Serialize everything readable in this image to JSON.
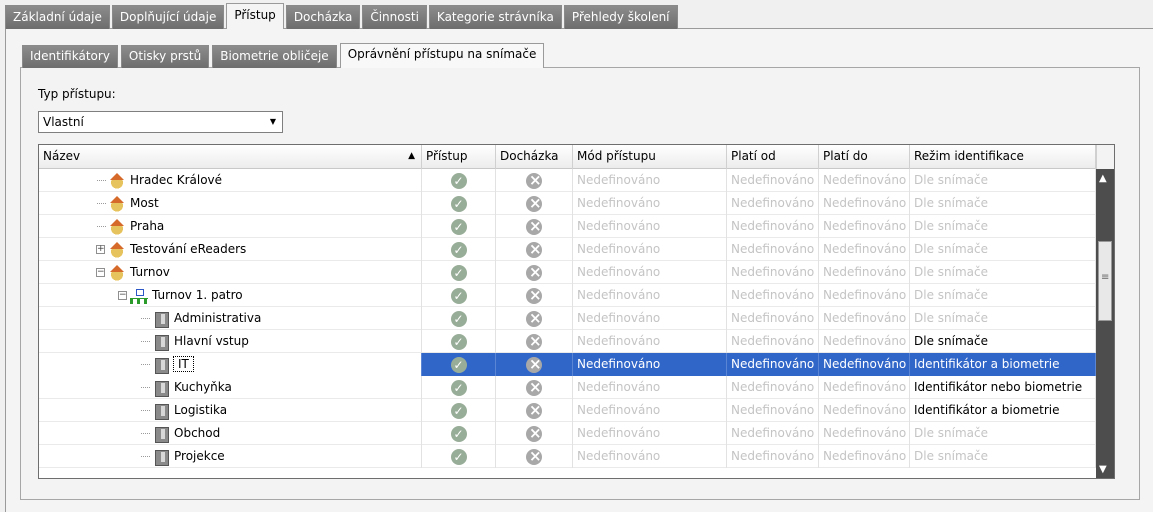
{
  "tabs_top": [
    "Základní údaje",
    "Doplňující údaje",
    "Přístup",
    "Docházka",
    "Činnosti",
    "Kategorie strávníka",
    "Přehledy školení"
  ],
  "tabs_top_active": 2,
  "tabs_inner": [
    "Identifikátory",
    "Otisky prstů",
    "Biometrie obličeje",
    "Oprávnění přístupu na snímače"
  ],
  "tabs_inner_active": 3,
  "access_type": {
    "label": "Typ přístupu:",
    "value": "Vlastní"
  },
  "grid": {
    "columns": [
      "Název",
      "Přístup",
      "Docházka",
      "Mód přístupu",
      "Platí od",
      "Platí do",
      "Režim identifikace"
    ],
    "rows": [
      {
        "name": "Hradec Králové",
        "icon": "house",
        "level": 1,
        "expander": "",
        "access": "ok",
        "attendance": "no",
        "mode": "Nedefinováno",
        "from": "Nedefinováno",
        "to": "Nedefinováno",
        "regime": "Dle snímače",
        "mode_muted": true,
        "regime_muted": true
      },
      {
        "name": "Most",
        "icon": "house",
        "level": 1,
        "expander": "",
        "access": "ok",
        "attendance": "no",
        "mode": "Nedefinováno",
        "from": "Nedefinováno",
        "to": "Nedefinováno",
        "regime": "Dle snímače",
        "mode_muted": true,
        "regime_muted": true
      },
      {
        "name": "Praha",
        "icon": "house",
        "level": 1,
        "expander": "",
        "access": "ok",
        "attendance": "no",
        "mode": "Nedefinováno",
        "from": "Nedefinováno",
        "to": "Nedefinováno",
        "regime": "Dle snímače",
        "mode_muted": true,
        "regime_muted": true
      },
      {
        "name": "Testování eReaders",
        "icon": "house",
        "level": 1,
        "expander": "+",
        "access": "ok",
        "attendance": "no",
        "mode": "Nedefinováno",
        "from": "Nedefinováno",
        "to": "Nedefinováno",
        "regime": "Dle snímače",
        "mode_muted": true,
        "regime_muted": true
      },
      {
        "name": "Turnov",
        "icon": "house",
        "level": 1,
        "expander": "−",
        "access": "ok",
        "attendance": "no",
        "mode": "Nedefinováno",
        "from": "Nedefinováno",
        "to": "Nedefinováno",
        "regime": "Dle snímače",
        "mode_muted": true,
        "regime_muted": true
      },
      {
        "name": "Turnov 1. patro",
        "icon": "net",
        "level": 2,
        "expander": "−",
        "access": "ok",
        "attendance": "no",
        "mode": "Nedefinováno",
        "from": "Nedefinováno",
        "to": "Nedefinováno",
        "regime": "Dle snímače",
        "mode_muted": true,
        "regime_muted": true
      },
      {
        "name": "Administrativa",
        "icon": "door",
        "level": 3,
        "expander": "",
        "access": "ok",
        "attendance": "no",
        "mode": "Nedefinováno",
        "from": "Nedefinováno",
        "to": "Nedefinováno",
        "regime": "Dle snímače",
        "mode_muted": true,
        "regime_muted": true
      },
      {
        "name": "Hlavní vstup",
        "icon": "door",
        "level": 3,
        "expander": "",
        "access": "ok",
        "attendance": "no",
        "mode": "Nedefinováno",
        "from": "Nedefinováno",
        "to": "Nedefinováno",
        "regime": "Dle snímače",
        "mode_muted": true,
        "regime_muted": false
      },
      {
        "name": "IT",
        "icon": "door",
        "level": 3,
        "expander": "",
        "access": "ok",
        "attendance": "no",
        "mode": "Nedefinováno",
        "from": "Nedefinováno",
        "to": "Nedefinováno",
        "regime": "Identifikátor a biometrie",
        "mode_muted": false,
        "regime_muted": false,
        "selected": true
      },
      {
        "name": "Kuchyňka",
        "icon": "door",
        "level": 3,
        "expander": "",
        "access": "ok",
        "attendance": "no",
        "mode": "Nedefinováno",
        "from": "Nedefinováno",
        "to": "Nedefinováno",
        "regime": "Identifikátor nebo biometrie",
        "mode_muted": true,
        "regime_muted": false
      },
      {
        "name": "Logistika",
        "icon": "door",
        "level": 3,
        "expander": "",
        "access": "ok",
        "attendance": "no",
        "mode": "Nedefinováno",
        "from": "Nedefinováno",
        "to": "Nedefinováno",
        "regime": "Identifikátor a biometrie",
        "mode_muted": true,
        "regime_muted": false
      },
      {
        "name": "Obchod",
        "icon": "door",
        "level": 3,
        "expander": "",
        "access": "ok",
        "attendance": "no",
        "mode": "Nedefinováno",
        "from": "Nedefinováno",
        "to": "Nedefinováno",
        "regime": "Dle snímače",
        "mode_muted": true,
        "regime_muted": true
      },
      {
        "name": "Projekce",
        "icon": "door",
        "level": 3,
        "expander": "",
        "access": "ok",
        "attendance": "no",
        "mode": "Nedefinováno",
        "from": "Nedefinováno",
        "to": "Nedefinováno",
        "regime": "Dle snímače",
        "mode_muted": true,
        "regime_muted": true
      }
    ]
  },
  "colors": {
    "selection": "#3166c9",
    "muted_text": "#c4c4c4",
    "tab_bg": "#767676"
  }
}
